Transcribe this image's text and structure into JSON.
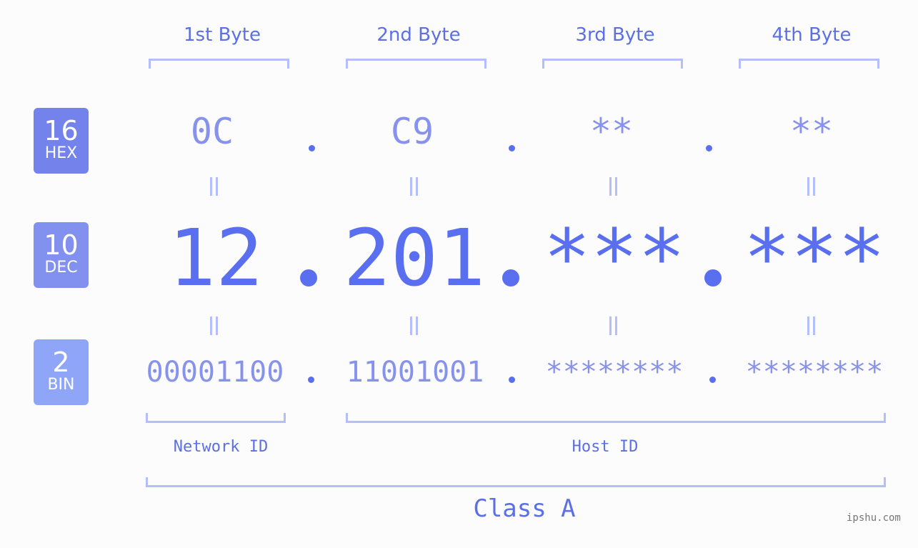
{
  "byte_headers": [
    "1st Byte",
    "2nd Byte",
    "3rd Byte",
    "4th Byte"
  ],
  "rows": {
    "hex": {
      "badge_num": "16",
      "badge_label": "HEX",
      "values": [
        "0C",
        "C9",
        "**",
        "**"
      ]
    },
    "dec": {
      "badge_num": "10",
      "badge_label": "DEC",
      "values": [
        "12",
        "201",
        "***",
        "***"
      ]
    },
    "bin": {
      "badge_num": "2",
      "badge_label": "BIN",
      "values": [
        "00001100",
        "11001001",
        "********",
        "********"
      ]
    }
  },
  "sections": {
    "network": "Network ID",
    "host": "Host ID"
  },
  "ip_class": "Class A",
  "watermark": "ipshu.com",
  "colors": {
    "hex_badge": "#7483ec",
    "dec_badge": "#8290f0",
    "bin_badge": "#8fa6f8",
    "accent": "#5a6ff0",
    "bracket": "#b3befa"
  }
}
